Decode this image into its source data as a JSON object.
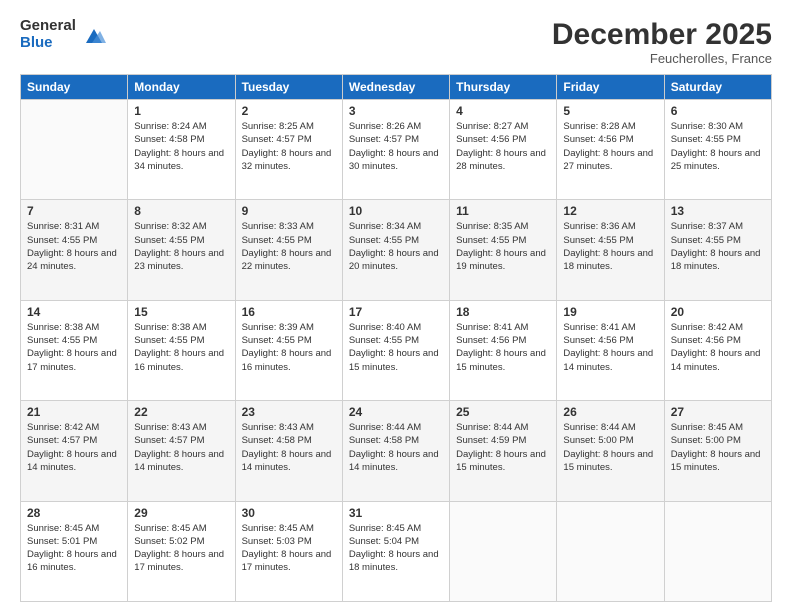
{
  "logo": {
    "general": "General",
    "blue": "Blue"
  },
  "header": {
    "month": "December 2025",
    "location": "Feucherolles, France"
  },
  "days": [
    "Sunday",
    "Monday",
    "Tuesday",
    "Wednesday",
    "Thursday",
    "Friday",
    "Saturday"
  ],
  "weeks": [
    [
      {
        "date": "",
        "sunrise": "",
        "sunset": "",
        "daylight": ""
      },
      {
        "date": "1",
        "sunrise": "Sunrise: 8:24 AM",
        "sunset": "Sunset: 4:58 PM",
        "daylight": "Daylight: 8 hours and 34 minutes."
      },
      {
        "date": "2",
        "sunrise": "Sunrise: 8:25 AM",
        "sunset": "Sunset: 4:57 PM",
        "daylight": "Daylight: 8 hours and 32 minutes."
      },
      {
        "date": "3",
        "sunrise": "Sunrise: 8:26 AM",
        "sunset": "Sunset: 4:57 PM",
        "daylight": "Daylight: 8 hours and 30 minutes."
      },
      {
        "date": "4",
        "sunrise": "Sunrise: 8:27 AM",
        "sunset": "Sunset: 4:56 PM",
        "daylight": "Daylight: 8 hours and 28 minutes."
      },
      {
        "date": "5",
        "sunrise": "Sunrise: 8:28 AM",
        "sunset": "Sunset: 4:56 PM",
        "daylight": "Daylight: 8 hours and 27 minutes."
      },
      {
        "date": "6",
        "sunrise": "Sunrise: 8:30 AM",
        "sunset": "Sunset: 4:55 PM",
        "daylight": "Daylight: 8 hours and 25 minutes."
      }
    ],
    [
      {
        "date": "7",
        "sunrise": "Sunrise: 8:31 AM",
        "sunset": "Sunset: 4:55 PM",
        "daylight": "Daylight: 8 hours and 24 minutes."
      },
      {
        "date": "8",
        "sunrise": "Sunrise: 8:32 AM",
        "sunset": "Sunset: 4:55 PM",
        "daylight": "Daylight: 8 hours and 23 minutes."
      },
      {
        "date": "9",
        "sunrise": "Sunrise: 8:33 AM",
        "sunset": "Sunset: 4:55 PM",
        "daylight": "Daylight: 8 hours and 22 minutes."
      },
      {
        "date": "10",
        "sunrise": "Sunrise: 8:34 AM",
        "sunset": "Sunset: 4:55 PM",
        "daylight": "Daylight: 8 hours and 20 minutes."
      },
      {
        "date": "11",
        "sunrise": "Sunrise: 8:35 AM",
        "sunset": "Sunset: 4:55 PM",
        "daylight": "Daylight: 8 hours and 19 minutes."
      },
      {
        "date": "12",
        "sunrise": "Sunrise: 8:36 AM",
        "sunset": "Sunset: 4:55 PM",
        "daylight": "Daylight: 8 hours and 18 minutes."
      },
      {
        "date": "13",
        "sunrise": "Sunrise: 8:37 AM",
        "sunset": "Sunset: 4:55 PM",
        "daylight": "Daylight: 8 hours and 18 minutes."
      }
    ],
    [
      {
        "date": "14",
        "sunrise": "Sunrise: 8:38 AM",
        "sunset": "Sunset: 4:55 PM",
        "daylight": "Daylight: 8 hours and 17 minutes."
      },
      {
        "date": "15",
        "sunrise": "Sunrise: 8:38 AM",
        "sunset": "Sunset: 4:55 PM",
        "daylight": "Daylight: 8 hours and 16 minutes."
      },
      {
        "date": "16",
        "sunrise": "Sunrise: 8:39 AM",
        "sunset": "Sunset: 4:55 PM",
        "daylight": "Daylight: 8 hours and 16 minutes."
      },
      {
        "date": "17",
        "sunrise": "Sunrise: 8:40 AM",
        "sunset": "Sunset: 4:55 PM",
        "daylight": "Daylight: 8 hours and 15 minutes."
      },
      {
        "date": "18",
        "sunrise": "Sunrise: 8:41 AM",
        "sunset": "Sunset: 4:56 PM",
        "daylight": "Daylight: 8 hours and 15 minutes."
      },
      {
        "date": "19",
        "sunrise": "Sunrise: 8:41 AM",
        "sunset": "Sunset: 4:56 PM",
        "daylight": "Daylight: 8 hours and 14 minutes."
      },
      {
        "date": "20",
        "sunrise": "Sunrise: 8:42 AM",
        "sunset": "Sunset: 4:56 PM",
        "daylight": "Daylight: 8 hours and 14 minutes."
      }
    ],
    [
      {
        "date": "21",
        "sunrise": "Sunrise: 8:42 AM",
        "sunset": "Sunset: 4:57 PM",
        "daylight": "Daylight: 8 hours and 14 minutes."
      },
      {
        "date": "22",
        "sunrise": "Sunrise: 8:43 AM",
        "sunset": "Sunset: 4:57 PM",
        "daylight": "Daylight: 8 hours and 14 minutes."
      },
      {
        "date": "23",
        "sunrise": "Sunrise: 8:43 AM",
        "sunset": "Sunset: 4:58 PM",
        "daylight": "Daylight: 8 hours and 14 minutes."
      },
      {
        "date": "24",
        "sunrise": "Sunrise: 8:44 AM",
        "sunset": "Sunset: 4:58 PM",
        "daylight": "Daylight: 8 hours and 14 minutes."
      },
      {
        "date": "25",
        "sunrise": "Sunrise: 8:44 AM",
        "sunset": "Sunset: 4:59 PM",
        "daylight": "Daylight: 8 hours and 15 minutes."
      },
      {
        "date": "26",
        "sunrise": "Sunrise: 8:44 AM",
        "sunset": "Sunset: 5:00 PM",
        "daylight": "Daylight: 8 hours and 15 minutes."
      },
      {
        "date": "27",
        "sunrise": "Sunrise: 8:45 AM",
        "sunset": "Sunset: 5:00 PM",
        "daylight": "Daylight: 8 hours and 15 minutes."
      }
    ],
    [
      {
        "date": "28",
        "sunrise": "Sunrise: 8:45 AM",
        "sunset": "Sunset: 5:01 PM",
        "daylight": "Daylight: 8 hours and 16 minutes."
      },
      {
        "date": "29",
        "sunrise": "Sunrise: 8:45 AM",
        "sunset": "Sunset: 5:02 PM",
        "daylight": "Daylight: 8 hours and 17 minutes."
      },
      {
        "date": "30",
        "sunrise": "Sunrise: 8:45 AM",
        "sunset": "Sunset: 5:03 PM",
        "daylight": "Daylight: 8 hours and 17 minutes."
      },
      {
        "date": "31",
        "sunrise": "Sunrise: 8:45 AM",
        "sunset": "Sunset: 5:04 PM",
        "daylight": "Daylight: 8 hours and 18 minutes."
      },
      {
        "date": "",
        "sunrise": "",
        "sunset": "",
        "daylight": ""
      },
      {
        "date": "",
        "sunrise": "",
        "sunset": "",
        "daylight": ""
      },
      {
        "date": "",
        "sunrise": "",
        "sunset": "",
        "daylight": ""
      }
    ]
  ]
}
